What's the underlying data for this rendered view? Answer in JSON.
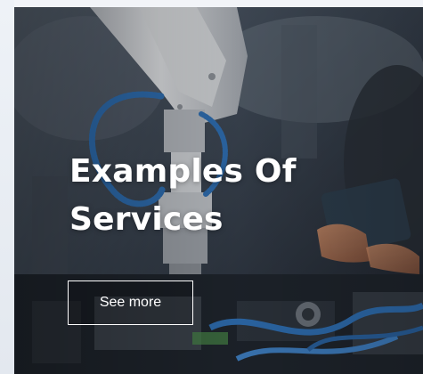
{
  "hero": {
    "title_line_1": "Examples Of",
    "title_line_2": "Services",
    "button_label": "See more",
    "background_image": "robotic-arm-factory-photo"
  },
  "colors": {
    "text": "#ffffff",
    "button_border": "#ffffff",
    "cable_blue": "#2f6fb3",
    "robot_gray": "#c9ccd0"
  }
}
